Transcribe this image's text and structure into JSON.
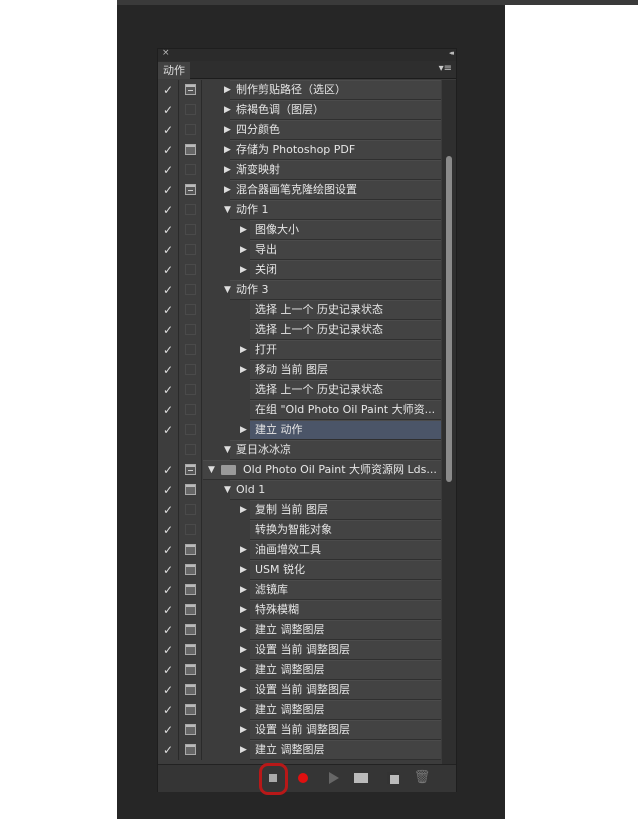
{
  "panel": {
    "close": "×",
    "collapse": "◂◂",
    "tab": "动作",
    "menu_icon": "▾≡"
  },
  "rows": [
    {
      "label": "制作剪贴路径（选区）",
      "check": true,
      "dialog": "part",
      "level": 0,
      "expand": "collapsed"
    },
    {
      "label": "棕褐色调（图层）",
      "check": true,
      "dialog": "none",
      "level": 0,
      "expand": "collapsed"
    },
    {
      "label": "四分颜色",
      "check": true,
      "dialog": "none",
      "level": 0,
      "expand": "collapsed"
    },
    {
      "label": "存储为 Photoshop PDF",
      "check": true,
      "dialog": "full",
      "level": 0,
      "expand": "collapsed"
    },
    {
      "label": "渐变映射",
      "check": true,
      "dialog": "none",
      "level": 0,
      "expand": "collapsed"
    },
    {
      "label": "混合器画笔克隆绘图设置",
      "check": true,
      "dialog": "part",
      "level": 0,
      "expand": "collapsed"
    },
    {
      "label": "动作 1",
      "check": true,
      "dialog": "none",
      "level": 0,
      "expand": "expanded"
    },
    {
      "label": "图像大小",
      "check": true,
      "dialog": "none",
      "level": 1,
      "expand": "collapsed"
    },
    {
      "label": "导出",
      "check": true,
      "dialog": "none",
      "level": 1,
      "expand": "collapsed"
    },
    {
      "label": "关闭",
      "check": true,
      "dialog": "none",
      "level": 1,
      "expand": "collapsed"
    },
    {
      "label": "动作 3",
      "check": true,
      "dialog": "none",
      "level": 0,
      "expand": "expanded"
    },
    {
      "label": "选择 上一个 历史记录状态",
      "check": true,
      "dialog": "none",
      "level": 1,
      "expand": "none"
    },
    {
      "label": "选择 上一个 历史记录状态",
      "check": true,
      "dialog": "none",
      "level": 1,
      "expand": "none"
    },
    {
      "label": "打开",
      "check": true,
      "dialog": "none",
      "level": 1,
      "expand": "collapsed"
    },
    {
      "label": "移动 当前 图层",
      "check": true,
      "dialog": "none",
      "level": 1,
      "expand": "collapsed"
    },
    {
      "label": "选择 上一个 历史记录状态",
      "check": true,
      "dialog": "none",
      "level": 1,
      "expand": "none"
    },
    {
      "label": "在组 \"Old Photo Oil Paint 大师资...",
      "check": true,
      "dialog": "none",
      "level": 1,
      "expand": "none"
    },
    {
      "label": "建立 动作",
      "check": true,
      "dialog": "none",
      "level": 1,
      "expand": "collapsed",
      "selected": true
    },
    {
      "label": "夏日冰冰凉",
      "check": false,
      "dialog": "none",
      "level": 0,
      "expand": "expanded"
    },
    {
      "label": "Old Photo Oil Paint 大师资源网 Lds...",
      "check": true,
      "dialog": "part",
      "level": -1,
      "expand": "expanded",
      "folder": true
    },
    {
      "label": "Old 1",
      "check": true,
      "dialog": "full",
      "level": 0,
      "expand": "expanded"
    },
    {
      "label": "复制 当前 图层",
      "check": true,
      "dialog": "none",
      "level": 1,
      "expand": "collapsed"
    },
    {
      "label": "转换为智能对象",
      "check": true,
      "dialog": "none",
      "level": 1,
      "expand": "none"
    },
    {
      "label": "油画增效工具",
      "check": true,
      "dialog": "full",
      "level": 1,
      "expand": "collapsed"
    },
    {
      "label": "USM 锐化",
      "check": true,
      "dialog": "full",
      "level": 1,
      "expand": "collapsed"
    },
    {
      "label": "滤镜库",
      "check": true,
      "dialog": "full",
      "level": 1,
      "expand": "collapsed"
    },
    {
      "label": "特殊模糊",
      "check": true,
      "dialog": "full",
      "level": 1,
      "expand": "collapsed"
    },
    {
      "label": "建立 调整图层",
      "check": true,
      "dialog": "full",
      "level": 1,
      "expand": "collapsed"
    },
    {
      "label": "设置 当前 调整图层",
      "check": true,
      "dialog": "full",
      "level": 1,
      "expand": "collapsed"
    },
    {
      "label": "建立 调整图层",
      "check": true,
      "dialog": "full",
      "level": 1,
      "expand": "collapsed"
    },
    {
      "label": "设置 当前 调整图层",
      "check": true,
      "dialog": "full",
      "level": 1,
      "expand": "collapsed"
    },
    {
      "label": "建立 调整图层",
      "check": true,
      "dialog": "full",
      "level": 1,
      "expand": "collapsed"
    },
    {
      "label": "设置 当前 调整图层",
      "check": true,
      "dialog": "full",
      "level": 1,
      "expand": "collapsed"
    },
    {
      "label": "建立 调整图层",
      "check": true,
      "dialog": "full",
      "level": 1,
      "expand": "collapsed"
    }
  ],
  "toolbar": {
    "buttons": [
      "stop-icon",
      "record-icon",
      "play-icon",
      "new-set-icon",
      "new-action-icon",
      "trash-icon"
    ],
    "highlight": "stop-button",
    "highlight_color": "#b81818",
    "record_color": "#e01010"
  },
  "icons": {
    "check": "✓",
    "collapsed": "▶",
    "expanded": "▼",
    "trash": "🗑"
  }
}
